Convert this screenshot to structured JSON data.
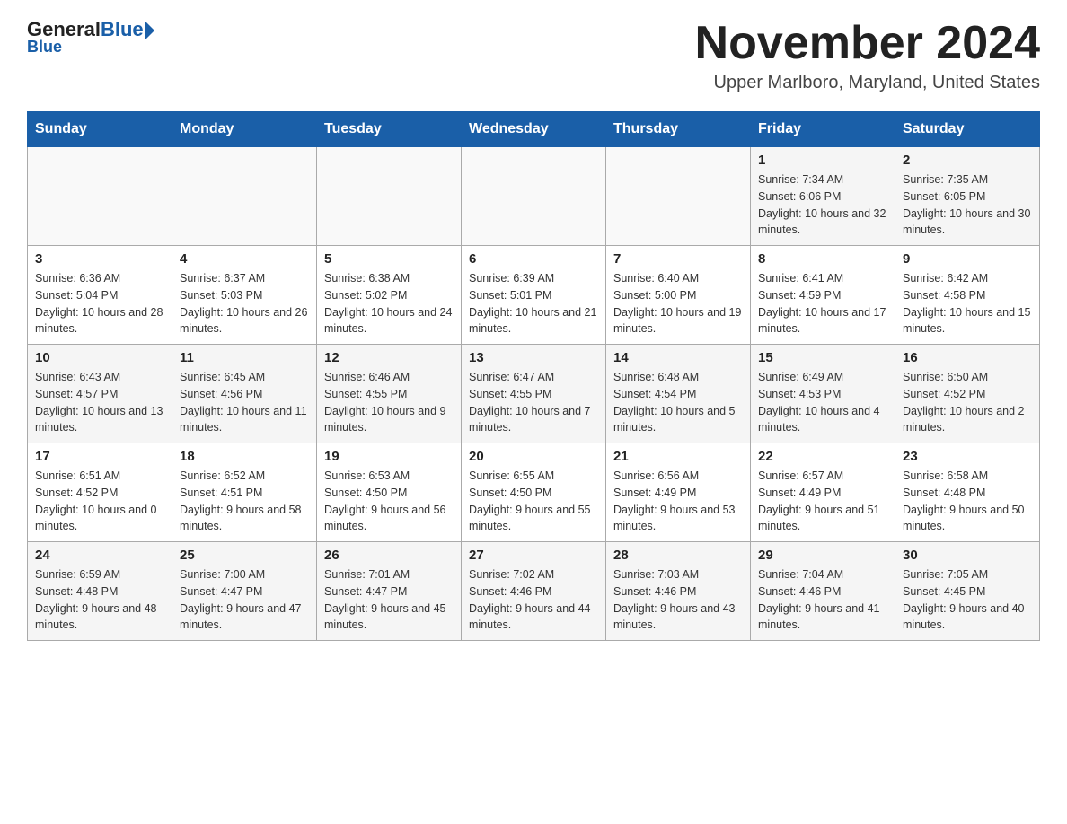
{
  "header": {
    "logo_general": "General",
    "logo_blue": "Blue",
    "month_title": "November 2024",
    "location": "Upper Marlboro, Maryland, United States"
  },
  "calendar": {
    "days_of_week": [
      "Sunday",
      "Monday",
      "Tuesday",
      "Wednesday",
      "Thursday",
      "Friday",
      "Saturday"
    ],
    "weeks": [
      [
        {
          "day": "",
          "info": ""
        },
        {
          "day": "",
          "info": ""
        },
        {
          "day": "",
          "info": ""
        },
        {
          "day": "",
          "info": ""
        },
        {
          "day": "",
          "info": ""
        },
        {
          "day": "1",
          "info": "Sunrise: 7:34 AM\nSunset: 6:06 PM\nDaylight: 10 hours and 32 minutes."
        },
        {
          "day": "2",
          "info": "Sunrise: 7:35 AM\nSunset: 6:05 PM\nDaylight: 10 hours and 30 minutes."
        }
      ],
      [
        {
          "day": "3",
          "info": "Sunrise: 6:36 AM\nSunset: 5:04 PM\nDaylight: 10 hours and 28 minutes."
        },
        {
          "day": "4",
          "info": "Sunrise: 6:37 AM\nSunset: 5:03 PM\nDaylight: 10 hours and 26 minutes."
        },
        {
          "day": "5",
          "info": "Sunrise: 6:38 AM\nSunset: 5:02 PM\nDaylight: 10 hours and 24 minutes."
        },
        {
          "day": "6",
          "info": "Sunrise: 6:39 AM\nSunset: 5:01 PM\nDaylight: 10 hours and 21 minutes."
        },
        {
          "day": "7",
          "info": "Sunrise: 6:40 AM\nSunset: 5:00 PM\nDaylight: 10 hours and 19 minutes."
        },
        {
          "day": "8",
          "info": "Sunrise: 6:41 AM\nSunset: 4:59 PM\nDaylight: 10 hours and 17 minutes."
        },
        {
          "day": "9",
          "info": "Sunrise: 6:42 AM\nSunset: 4:58 PM\nDaylight: 10 hours and 15 minutes."
        }
      ],
      [
        {
          "day": "10",
          "info": "Sunrise: 6:43 AM\nSunset: 4:57 PM\nDaylight: 10 hours and 13 minutes."
        },
        {
          "day": "11",
          "info": "Sunrise: 6:45 AM\nSunset: 4:56 PM\nDaylight: 10 hours and 11 minutes."
        },
        {
          "day": "12",
          "info": "Sunrise: 6:46 AM\nSunset: 4:55 PM\nDaylight: 10 hours and 9 minutes."
        },
        {
          "day": "13",
          "info": "Sunrise: 6:47 AM\nSunset: 4:55 PM\nDaylight: 10 hours and 7 minutes."
        },
        {
          "day": "14",
          "info": "Sunrise: 6:48 AM\nSunset: 4:54 PM\nDaylight: 10 hours and 5 minutes."
        },
        {
          "day": "15",
          "info": "Sunrise: 6:49 AM\nSunset: 4:53 PM\nDaylight: 10 hours and 4 minutes."
        },
        {
          "day": "16",
          "info": "Sunrise: 6:50 AM\nSunset: 4:52 PM\nDaylight: 10 hours and 2 minutes."
        }
      ],
      [
        {
          "day": "17",
          "info": "Sunrise: 6:51 AM\nSunset: 4:52 PM\nDaylight: 10 hours and 0 minutes."
        },
        {
          "day": "18",
          "info": "Sunrise: 6:52 AM\nSunset: 4:51 PM\nDaylight: 9 hours and 58 minutes."
        },
        {
          "day": "19",
          "info": "Sunrise: 6:53 AM\nSunset: 4:50 PM\nDaylight: 9 hours and 56 minutes."
        },
        {
          "day": "20",
          "info": "Sunrise: 6:55 AM\nSunset: 4:50 PM\nDaylight: 9 hours and 55 minutes."
        },
        {
          "day": "21",
          "info": "Sunrise: 6:56 AM\nSunset: 4:49 PM\nDaylight: 9 hours and 53 minutes."
        },
        {
          "day": "22",
          "info": "Sunrise: 6:57 AM\nSunset: 4:49 PM\nDaylight: 9 hours and 51 minutes."
        },
        {
          "day": "23",
          "info": "Sunrise: 6:58 AM\nSunset: 4:48 PM\nDaylight: 9 hours and 50 minutes."
        }
      ],
      [
        {
          "day": "24",
          "info": "Sunrise: 6:59 AM\nSunset: 4:48 PM\nDaylight: 9 hours and 48 minutes."
        },
        {
          "day": "25",
          "info": "Sunrise: 7:00 AM\nSunset: 4:47 PM\nDaylight: 9 hours and 47 minutes."
        },
        {
          "day": "26",
          "info": "Sunrise: 7:01 AM\nSunset: 4:47 PM\nDaylight: 9 hours and 45 minutes."
        },
        {
          "day": "27",
          "info": "Sunrise: 7:02 AM\nSunset: 4:46 PM\nDaylight: 9 hours and 44 minutes."
        },
        {
          "day": "28",
          "info": "Sunrise: 7:03 AM\nSunset: 4:46 PM\nDaylight: 9 hours and 43 minutes."
        },
        {
          "day": "29",
          "info": "Sunrise: 7:04 AM\nSunset: 4:46 PM\nDaylight: 9 hours and 41 minutes."
        },
        {
          "day": "30",
          "info": "Sunrise: 7:05 AM\nSunset: 4:45 PM\nDaylight: 9 hours and 40 minutes."
        }
      ]
    ]
  }
}
